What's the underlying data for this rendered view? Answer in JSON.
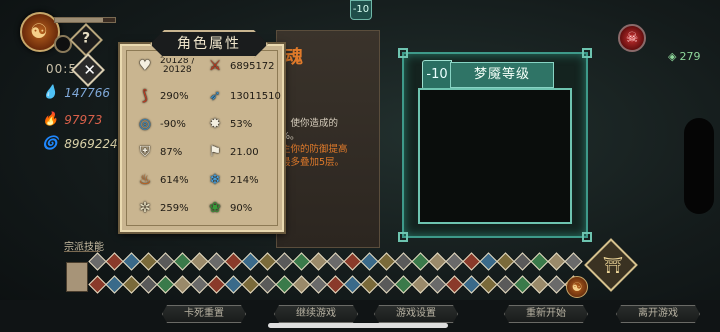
{
  "hud": {
    "timer": "00:5",
    "help_label": "?",
    "close_label": "✕",
    "stats": [
      {
        "icon": "water-icon",
        "value": "147766"
      },
      {
        "icon": "flame-icon",
        "value": "97973"
      },
      {
        "icon": "spiral-icon",
        "value": "8969224"
      }
    ]
  },
  "top": {
    "level_badge": "-10",
    "currency": "279"
  },
  "bg_card": {
    "title": "魂",
    "text_lines": [
      "，使你造成的",
      "%。",
      "主你的防御提高",
      "最多叠加5层。"
    ]
  },
  "attributes": {
    "title": "角色属性",
    "items": [
      {
        "name": "health",
        "icon": "heart-icon",
        "value": "20128 / 20128",
        "top": "20128 /",
        "bottom": "20128",
        "color": "#f4efe0"
      },
      {
        "name": "attack",
        "icon": "claw-icon",
        "value": "6895172",
        "color": "#c83a20"
      },
      {
        "name": "crit-damage",
        "icon": "slash-icon",
        "value": "290%",
        "color": "#c83a20"
      },
      {
        "name": "skill-damage",
        "icon": "dash-icon",
        "value": "13011510",
        "color": "#3a8ec8"
      },
      {
        "name": "cooldown",
        "icon": "ring-icon",
        "value": "-90%",
        "color": "#3a8ec8"
      },
      {
        "name": "crit-rate",
        "icon": "burst-icon",
        "value": "53%",
        "color": "#f4efe0"
      },
      {
        "name": "defense",
        "icon": "shield-icon",
        "value": "87%",
        "color": "#f4efe0"
      },
      {
        "name": "speed",
        "icon": "boot-icon",
        "value": "21.00",
        "color": "#f4efe0"
      },
      {
        "name": "fire-bonus",
        "icon": "fire-icon",
        "value": "614%",
        "color": "#e06a18"
      },
      {
        "name": "ice-bonus",
        "icon": "snowflake-icon",
        "value": "214%",
        "color": "#4aa8e8"
      },
      {
        "name": "dodge",
        "icon": "swirl-icon",
        "value": "259%",
        "color": "#e8e0c0"
      },
      {
        "name": "poison-bonus",
        "icon": "poison-icon",
        "value": "90%",
        "color": "#3a9a3a"
      }
    ]
  },
  "dream": {
    "badge": "-10",
    "title": "梦魇等级"
  },
  "skills": {
    "label": "宗派技能",
    "count": 58
  },
  "menu": {
    "buttons": [
      "卡死重置",
      "继续游戏",
      "游戏设置",
      "重新开始",
      "离开游戏"
    ]
  }
}
